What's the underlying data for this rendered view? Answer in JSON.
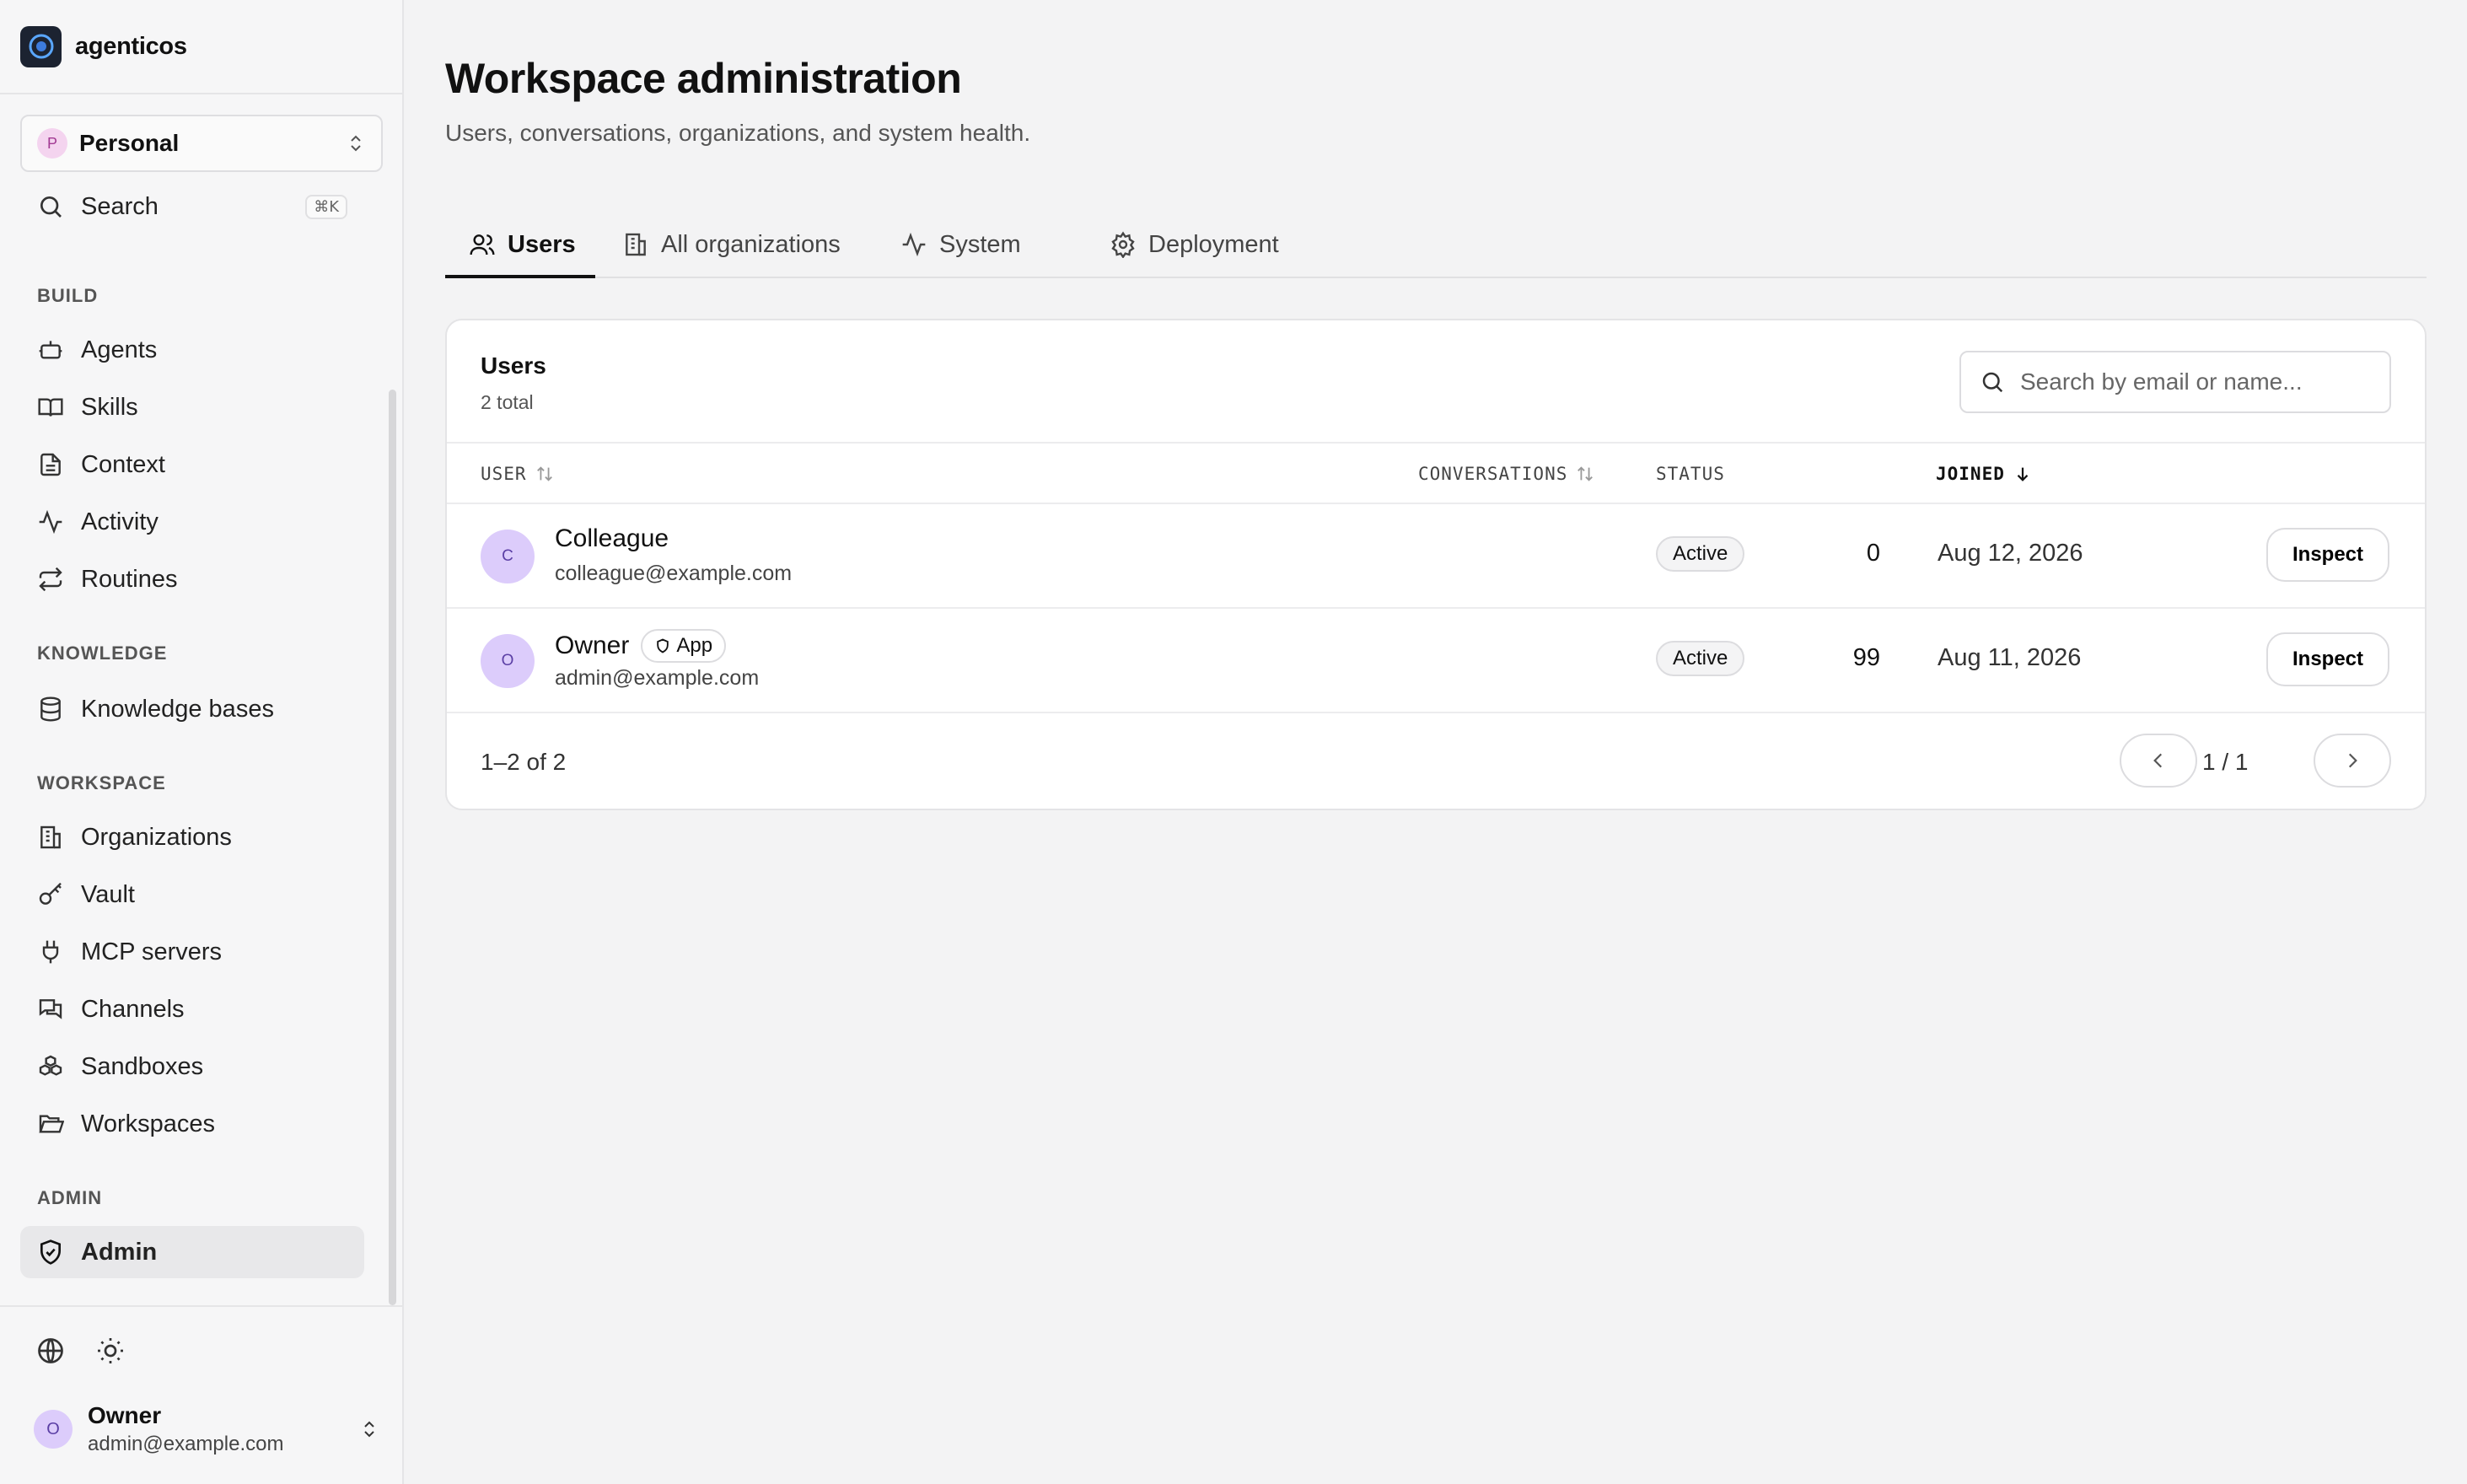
{
  "app": {
    "name": "agenticos"
  },
  "workspace": {
    "avatar": "P",
    "name": "Personal"
  },
  "search": {
    "label": "Search",
    "shortcut": "⌘K"
  },
  "sidebar": {
    "sections": {
      "build": "BUILD",
      "knowledge": "KNOWLEDGE",
      "workspace": "WORKSPACE",
      "admin": "ADMIN"
    },
    "build_items": [
      "Agents",
      "Skills",
      "Context",
      "Activity",
      "Routines"
    ],
    "knowledge_items": [
      "Knowledge bases"
    ],
    "workspace_items": [
      "Organizations",
      "Vault",
      "MCP servers",
      "Channels",
      "Sandboxes",
      "Workspaces"
    ],
    "admin_items": [
      "Admin"
    ],
    "active_item": "Admin"
  },
  "current_user": {
    "avatar": "O",
    "name": "Owner",
    "email": "admin@example.com"
  },
  "page": {
    "title": "Workspace administration",
    "subtitle": "Users, conversations, organizations, and system health."
  },
  "tabs": [
    {
      "label": "Users",
      "icon": "users-icon",
      "active": true
    },
    {
      "label": "All organizations",
      "icon": "building-icon",
      "active": false
    },
    {
      "label": "System",
      "icon": "activity-icon",
      "active": false
    },
    {
      "label": "Deployment",
      "icon": "gear-icon",
      "active": false
    }
  ],
  "users_card": {
    "title": "Users",
    "count": "2 total",
    "search_placeholder": "Search by email or name...",
    "columns": {
      "user": "USER",
      "conversations": "CONVERSATIONS",
      "status": "STATUS",
      "joined": "JOINED"
    },
    "rows": [
      {
        "avatar": "C",
        "name": "Colleague",
        "badge": "",
        "email": "colleague@example.com",
        "conversations": "0",
        "status": "Active",
        "joined": "Aug 12, 2026",
        "action": "Inspect"
      },
      {
        "avatar": "O",
        "name": "Owner",
        "badge": "App",
        "email": "admin@example.com",
        "conversations": "99",
        "status": "Active",
        "joined": "Aug 11, 2026",
        "action": "Inspect"
      }
    ],
    "range": "1–2 of 2",
    "page_info": "1 / 1"
  },
  "colors": {
    "accent": "#111111",
    "avatar_bg": "#dcccfb",
    "workspace_avatar_bg": "#f4d4ef"
  }
}
